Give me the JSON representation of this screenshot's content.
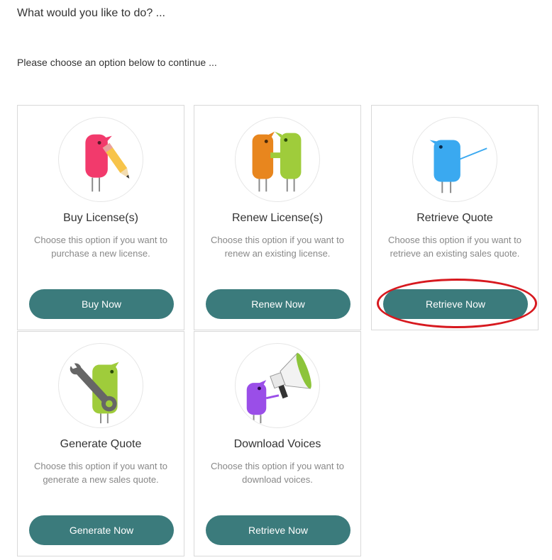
{
  "header": {
    "title": "What would you like to do? ...",
    "subtitle": "Please choose an option below to continue ..."
  },
  "cards": [
    {
      "title": "Buy License(s)",
      "description": "Choose this option if you want to purchase a new license.",
      "button": "Buy Now",
      "icon": "pink-bird-pencil-icon"
    },
    {
      "title": "Renew License(s)",
      "description": "Choose this option if you want to renew an existing license.",
      "button": "Renew Now",
      "icon": "two-birds-icon"
    },
    {
      "title": "Retrieve Quote",
      "description": "Choose this option if you want to retrieve an existing sales quote.",
      "button": "Retrieve Now",
      "icon": "blue-bird-icon"
    },
    {
      "title": "Generate Quote",
      "description": "Choose this option if you want to generate a new sales quote.",
      "button": "Generate Now",
      "icon": "green-bird-wrench-icon"
    },
    {
      "title": "Download Voices",
      "description": "Choose this option if you want to download voices.",
      "button": "Retrieve Now",
      "icon": "purple-bird-megaphone-icon"
    }
  ],
  "colors": {
    "button": "#3b7b7c",
    "highlight": "#d7191f"
  }
}
